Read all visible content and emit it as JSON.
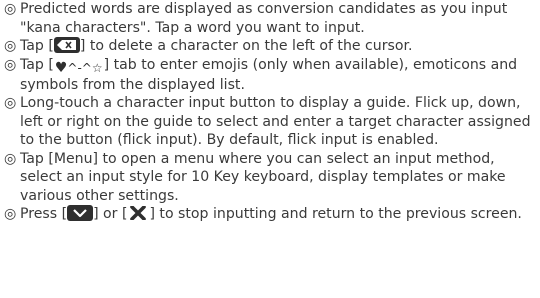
{
  "bullet_mark": "◎",
  "items": [
    {
      "segments": [
        "Predicted words are displayed as conversion candidates as you input \"kana characters\". Tap a word you want to input."
      ]
    },
    {
      "segments": [
        "Tap [",
        "] to delete a character on the left of the cursor."
      ],
      "icons": [
        "delete-key-icon"
      ]
    },
    {
      "segments": [
        "Tap [",
        "] tab to enter emojis (only when available), emoticons and symbols from the displayed list."
      ],
      "icons": [
        "emoji-tab-icon"
      ]
    },
    {
      "segments": [
        "Long-touch a character input button to display a guide. Flick up, down, left or right on the guide to select and enter a target character assigned to the button (flick input). By default, flick input is enabled."
      ]
    },
    {
      "segments": [
        "Tap [Menu] to open a menu where you can select an input method, select an input style for 10 Key keyboard, display templates or make various other settings."
      ]
    },
    {
      "segments": [
        "Press [",
        "] or [",
        "] to stop inputting and return to the previous screen."
      ],
      "icons": [
        "close-keyboard-icon",
        "x-mark-icon"
      ]
    }
  ],
  "emoji_tab_glyphs": {
    "heart": "♥",
    "face": "^-^",
    "star": "☆"
  }
}
